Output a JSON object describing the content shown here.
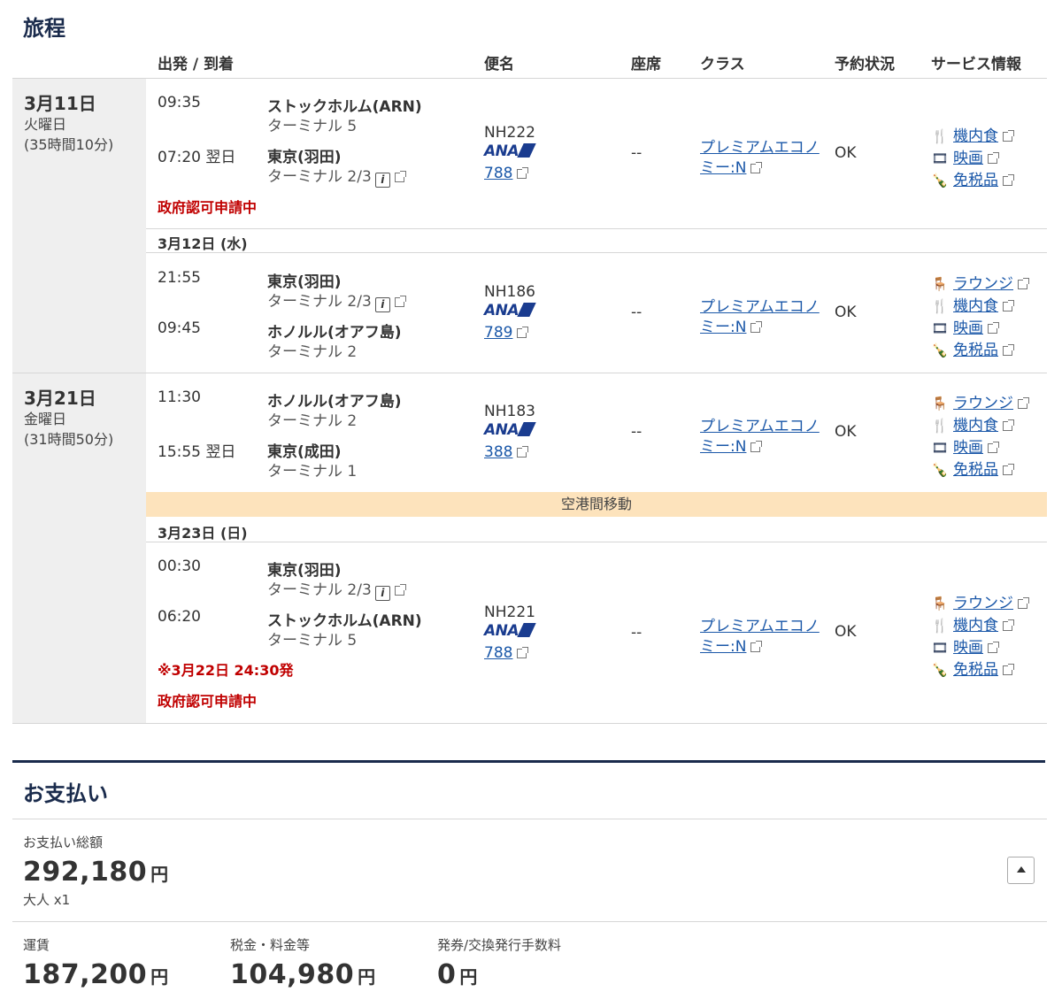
{
  "itinerary": {
    "title": "旅程",
    "headers": {
      "dep_arr": "出発 / 到着",
      "flight": "便名",
      "seat": "座席",
      "class": "クラス",
      "status": "予約状況",
      "service": "サービス情報"
    },
    "segments": [
      {
        "dep_time": "09:35",
        "dep_city": "ストックホルム(ARN)",
        "dep_term": "ターミナル 5",
        "arr_time": "07:20 翌日",
        "arr_city": "東京(羽田)",
        "arr_term": "ターミナル 2/3",
        "flight_no": "NH222",
        "aircraft": "788",
        "seat": "--",
        "class1": "プレミアムエコノ",
        "class2": "ミー:N",
        "status": "OK",
        "note": "政府認可申請中",
        "services": [
          "機内食",
          "映画",
          "免税品"
        ]
      },
      {
        "dep_time": "21:55",
        "dep_city": "東京(羽田)",
        "dep_term": "ターミナル 2/3",
        "arr_time": "09:45",
        "arr_city": "ホノルル(オアフ島)",
        "arr_term": "ターミナル 2",
        "flight_no": "NH186",
        "aircraft": "789",
        "seat": "--",
        "class1": "プレミアムエコノ",
        "class2": "ミー:N",
        "status": "OK",
        "services": [
          "ラウンジ",
          "機内食",
          "映画",
          "免税品"
        ]
      },
      {
        "dep_time": "11:30",
        "dep_city": "ホノルル(オアフ島)",
        "dep_term": "ターミナル 2",
        "arr_time": "15:55 翌日",
        "arr_city": "東京(成田)",
        "arr_term": "ターミナル 1",
        "flight_no": "NH183",
        "aircraft": "388",
        "seat": "--",
        "class1": "プレミアムエコノ",
        "class2": "ミー:N",
        "status": "OK",
        "services": [
          "ラウンジ",
          "機内食",
          "映画",
          "免税品"
        ]
      },
      {
        "dep_time": "00:30",
        "dep_city": "東京(羽田)",
        "dep_term": "ターミナル 2/3",
        "arr_time": "06:20",
        "arr_city": "ストックホルム(ARN)",
        "arr_term": "ターミナル 5",
        "flight_no": "NH221",
        "aircraft": "788",
        "seat": "--",
        "class1": "プレミアムエコノ",
        "class2": "ミー:N",
        "status": "OK",
        "note": "政府認可申請中",
        "note2": "※3月22日 24:30発",
        "services": [
          "ラウンジ",
          "機内食",
          "映画",
          "免税品"
        ]
      }
    ],
    "journeys": [
      {
        "date": "3月11日",
        "weekday": "火曜日",
        "duration": "(35時間10分)"
      },
      {
        "date": "3月21日",
        "weekday": "金曜日",
        "duration": "(31時間50分)"
      }
    ],
    "sub_dates": [
      "3月12日 (水)",
      "3月23日 (日)"
    ],
    "transfer": "空港間移動",
    "airline_logo": "ANA"
  },
  "payment": {
    "title": "お支払い",
    "total_label": "お支払い総額",
    "total": "292,180",
    "yen": "円",
    "pax": "大人 x1",
    "fare_label": "運賃",
    "fare": "187,200",
    "tax_label": "税金・料金等",
    "tax": "104,980",
    "fee_label": "発券/交換発行手数料",
    "fee": "0"
  },
  "icons": {
    "meal": "fork-knife-icon",
    "movie": "film-reel-icon",
    "dutyfree": "bottle-gift-icon",
    "lounge": "lounge-chair-icon",
    "external": "external-link-icon",
    "info": "info-icon"
  }
}
